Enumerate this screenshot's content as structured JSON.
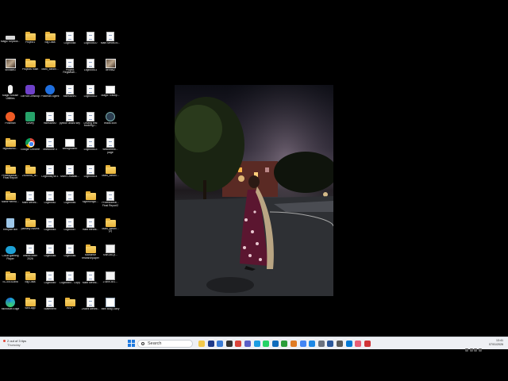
{
  "desktop": {
    "icons": [
      {
        "label": "Magic Keyboa...",
        "icon": "keyboard-icon",
        "type": "kbd"
      },
      {
        "label": "shihabru",
        "icon": "image-file-icon",
        "type": "img"
      },
      {
        "label": "Magic Mouse Utilities",
        "icon": "mouse-icon",
        "type": "mouse"
      },
      {
        "label": "Postman",
        "icon": "postman-icon",
        "type": "postman-orange"
      },
      {
        "label": "bigdatamo...",
        "icon": "folder-icon",
        "type": "folder"
      },
      {
        "label": "Professional... Final Report",
        "icon": "folder-icon",
        "type": "folder"
      },
      {
        "label": "MahiPhermo...",
        "icon": "folder-icon",
        "type": "folder"
      },
      {
        "label": "Recycle Bin",
        "icon": "recycle-bin-icon",
        "type": "recycle"
      },
      {
        "label": "Cloud gaming Player",
        "icon": "cloud-icon",
        "type": "cloud"
      },
      {
        "label": "SC3015Java",
        "icon": "folder-icon",
        "type": "folder"
      },
      {
        "label": "Microsoft Edge",
        "icon": "edge-icon",
        "type": "edge"
      },
      {
        "label": "Project1",
        "icon": "folder-icon",
        "type": "folder"
      },
      {
        "label": "Projects main",
        "icon": "folder-icon",
        "type": "folder"
      },
      {
        "label": "GitHub Desktop",
        "icon": "github-icon",
        "type": "github"
      },
      {
        "label": "survey",
        "icon": "app-icon",
        "type": "green"
      },
      {
        "label": "Google Chrome",
        "icon": "chrome-icon",
        "type": "chrome"
      },
      {
        "label": "2305596_fit...",
        "icon": "folder-icon",
        "type": "folder"
      },
      {
        "label": "Mahi Medhi...",
        "icon": "document-icon",
        "type": "doc"
      },
      {
        "label": "pantasy Assets",
        "icon": "folder-icon",
        "type": "folder"
      },
      {
        "label": "official letter 2026",
        "icon": "document-icon",
        "type": "doc"
      },
      {
        "label": "Big Data",
        "icon": "folder-icon",
        "type": "folder"
      },
      {
        "label": "web-app",
        "icon": "folder-icon",
        "type": "folder"
      },
      {
        "label": "Big Data",
        "icon": "folder-icon",
        "type": "folder"
      },
      {
        "label": "Mahi_Medhi...",
        "icon": "folder-icon",
        "type": "folder"
      },
      {
        "label": "Postman Agent",
        "icon": "postman-agent-icon",
        "type": "postman-blue"
      },
      {
        "label": "milestone2",
        "icon": "document-icon",
        "type": "doc"
      },
      {
        "label": "Milestone 3",
        "icon": "document-icon",
        "type": "doc"
      },
      {
        "label": "Logbook(No.1",
        "icon": "document-icon",
        "type": "doc"
      },
      {
        "label": "Logbook2",
        "icon": "document-icon",
        "type": "doc"
      },
      {
        "label": "Logbook3",
        "icon": "document-icon",
        "type": "doc"
      },
      {
        "label": "Logbook5",
        "icon": "document-icon",
        "type": "doc"
      },
      {
        "label": "Logbook9",
        "icon": "document-icon",
        "type": "doc"
      },
      {
        "label": "Statement",
        "icon": "document-icon",
        "type": "doc"
      },
      {
        "label": "Logbook8",
        "icon": "document-icon",
        "type": "doc"
      },
      {
        "label": "Project Registrati...",
        "icon": "document-icon",
        "type": "doc"
      },
      {
        "label": "Milestone1",
        "icon": "document-icon",
        "type": "doc"
      },
      {
        "label": "python assist key",
        "icon": "document-icon",
        "type": "doc"
      },
      {
        "label": "sendgridinfo",
        "icon": "white-file-icon",
        "type": "white"
      },
      {
        "label": "Mahi Chuadal...",
        "icon": "document-icon",
        "type": "doc"
      },
      {
        "label": "Logbook6",
        "icon": "document-icon",
        "type": "doc"
      },
      {
        "label": "Logbook7",
        "icon": "document-icon",
        "type": "doc"
      },
      {
        "label": "Logbook6",
        "icon": "document-icon",
        "type": "doc"
      },
      {
        "label": "Logbook4 - Copy",
        "icon": "document-icon",
        "type": "doc"
      },
      {
        "label": "cv4-+",
        "icon": "folder-icon",
        "type": "folder"
      },
      {
        "label": "Logbook10",
        "icon": "document-icon",
        "type": "doc"
      },
      {
        "label": "Logbook11",
        "icon": "document-icon",
        "type": "doc"
      },
      {
        "label": "Logbook12",
        "icon": "document-icon",
        "type": "doc"
      },
      {
        "label": "Driving test booking r...",
        "icon": "document-icon",
        "type": "doc"
      },
      {
        "label": "Logbook13",
        "icon": "document-icon",
        "type": "doc"
      },
      {
        "label": "Logbook14",
        "icon": "document-icon",
        "type": "doc"
      },
      {
        "label": "signedinglo...",
        "icon": "folder-icon",
        "type": "folder"
      },
      {
        "label": "mahi medhi...",
        "icon": "document-icon",
        "type": "doc"
      },
      {
        "label": "Mahdrive researchpaper",
        "icon": "folder-icon",
        "type": "folder"
      },
      {
        "label": "Mahi Medhi...",
        "icon": "document-icon",
        "type": "doc"
      },
      {
        "label": "ZMahi Medhi...",
        "icon": "document-icon",
        "type": "doc"
      },
      {
        "label": "Mahi Medhi-fo...",
        "icon": "document-icon",
        "type": "doc"
      },
      {
        "label": "dennis2",
        "icon": "image-file-icon",
        "type": "img"
      },
      {
        "label": "Magic Trackp...",
        "icon": "trackpad-icon",
        "type": "white"
      },
      {
        "label": "reads icon",
        "icon": "app-icon",
        "type": "teal"
      },
      {
        "label": "welcometo... page",
        "icon": "document-icon",
        "type": "doc"
      },
      {
        "label": "Mahi_Medhi...",
        "icon": "folder-icon",
        "type": "folder"
      },
      {
        "label": "Professional... Final Report2",
        "icon": "document-icon",
        "type": "doc"
      },
      {
        "label": "Mahi_Medhi... (2)",
        "icon": "folder-icon",
        "type": "folder"
      },
      {
        "label": "shih-tzu-p...",
        "icon": "pdf-file-icon",
        "type": "pdf"
      },
      {
        "label": "2-shih-tzu-...",
        "icon": "pdf-file-icon",
        "type": "pdf"
      },
      {
        "label": "Mini Blog Diary",
        "icon": "blog-icon",
        "type": "blog"
      }
    ]
  },
  "photo": {
    "description_hidden": "",
    "colors": {
      "sky": "#2a2533",
      "tree": "#141c10",
      "dress": "#5b1630",
      "road": "#2f3135",
      "light": "#ffb347"
    }
  },
  "taskbar": {
    "weather": {
      "line1": "2 out of 3 tips",
      "line2": "Thursday"
    },
    "search_placeholder": "Search",
    "apps": [
      {
        "name": "explorer-icon",
        "color": "#f2c84b"
      },
      {
        "name": "widgets-icon",
        "color": "#1f3a8a"
      },
      {
        "name": "store-icon",
        "color": "#3a7bd5"
      },
      {
        "name": "terminal-icon",
        "color": "#333"
      },
      {
        "name": "photos-icon",
        "color": "#d9433a"
      },
      {
        "name": "teams-icon",
        "color": "#5b5fc7"
      },
      {
        "name": "edge-icon",
        "color": "#1b9de2"
      },
      {
        "name": "whatsapp-icon",
        "color": "#25d366"
      },
      {
        "name": "outlook-icon",
        "color": "#0f6cbd"
      },
      {
        "name": "xbox-icon",
        "color": "#2a9d3a"
      },
      {
        "name": "vpn-icon",
        "color": "#e07b22"
      },
      {
        "name": "chrome-icon",
        "color": "#4285f4"
      },
      {
        "name": "vscode-icon",
        "color": "#1e88e5"
      },
      {
        "name": "settings-icon",
        "color": "#6b7280"
      },
      {
        "name": "word-icon",
        "color": "#2b579a"
      },
      {
        "name": "calculator-icon",
        "color": "#5a5a5a"
      },
      {
        "name": "mail-icon",
        "color": "#0078d4"
      },
      {
        "name": "photo-viewer-icon",
        "color": "#e85d75"
      },
      {
        "name": "snipping-icon",
        "color": "#d13438"
      }
    ],
    "clock": {
      "time": "13:41",
      "date": "07/01/2026"
    }
  }
}
